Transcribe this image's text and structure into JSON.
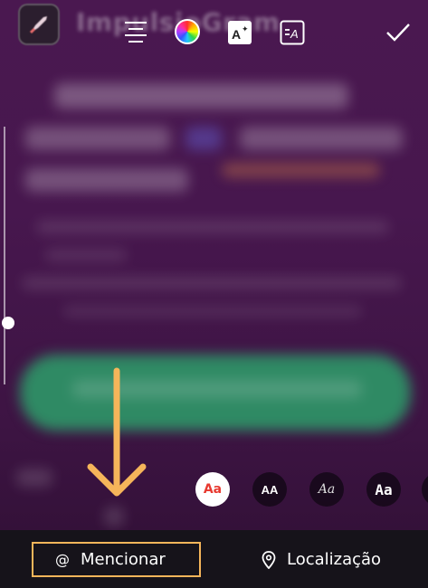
{
  "top_toolbar": {
    "app_name": "ImpulsioGram",
    "tools": [
      "align-icon",
      "color-wheel-icon",
      "text-effect-icon",
      "text-style-icon"
    ],
    "done_icon": "checkmark-icon"
  },
  "font_styles": [
    {
      "label": "Aa",
      "active": true
    },
    {
      "label": "AA",
      "active": false
    },
    {
      "label": "Aa",
      "active": false
    },
    {
      "label": "Aa",
      "active": false
    }
  ],
  "bottom_bar": {
    "mention": {
      "icon": "@",
      "label": "Mencionar"
    },
    "location": {
      "label": "Localização"
    }
  },
  "colors": {
    "background": "#47174e",
    "highlight": "#f5b55a",
    "bottom_bar": "#16131a",
    "active_font": "#e8392f"
  }
}
